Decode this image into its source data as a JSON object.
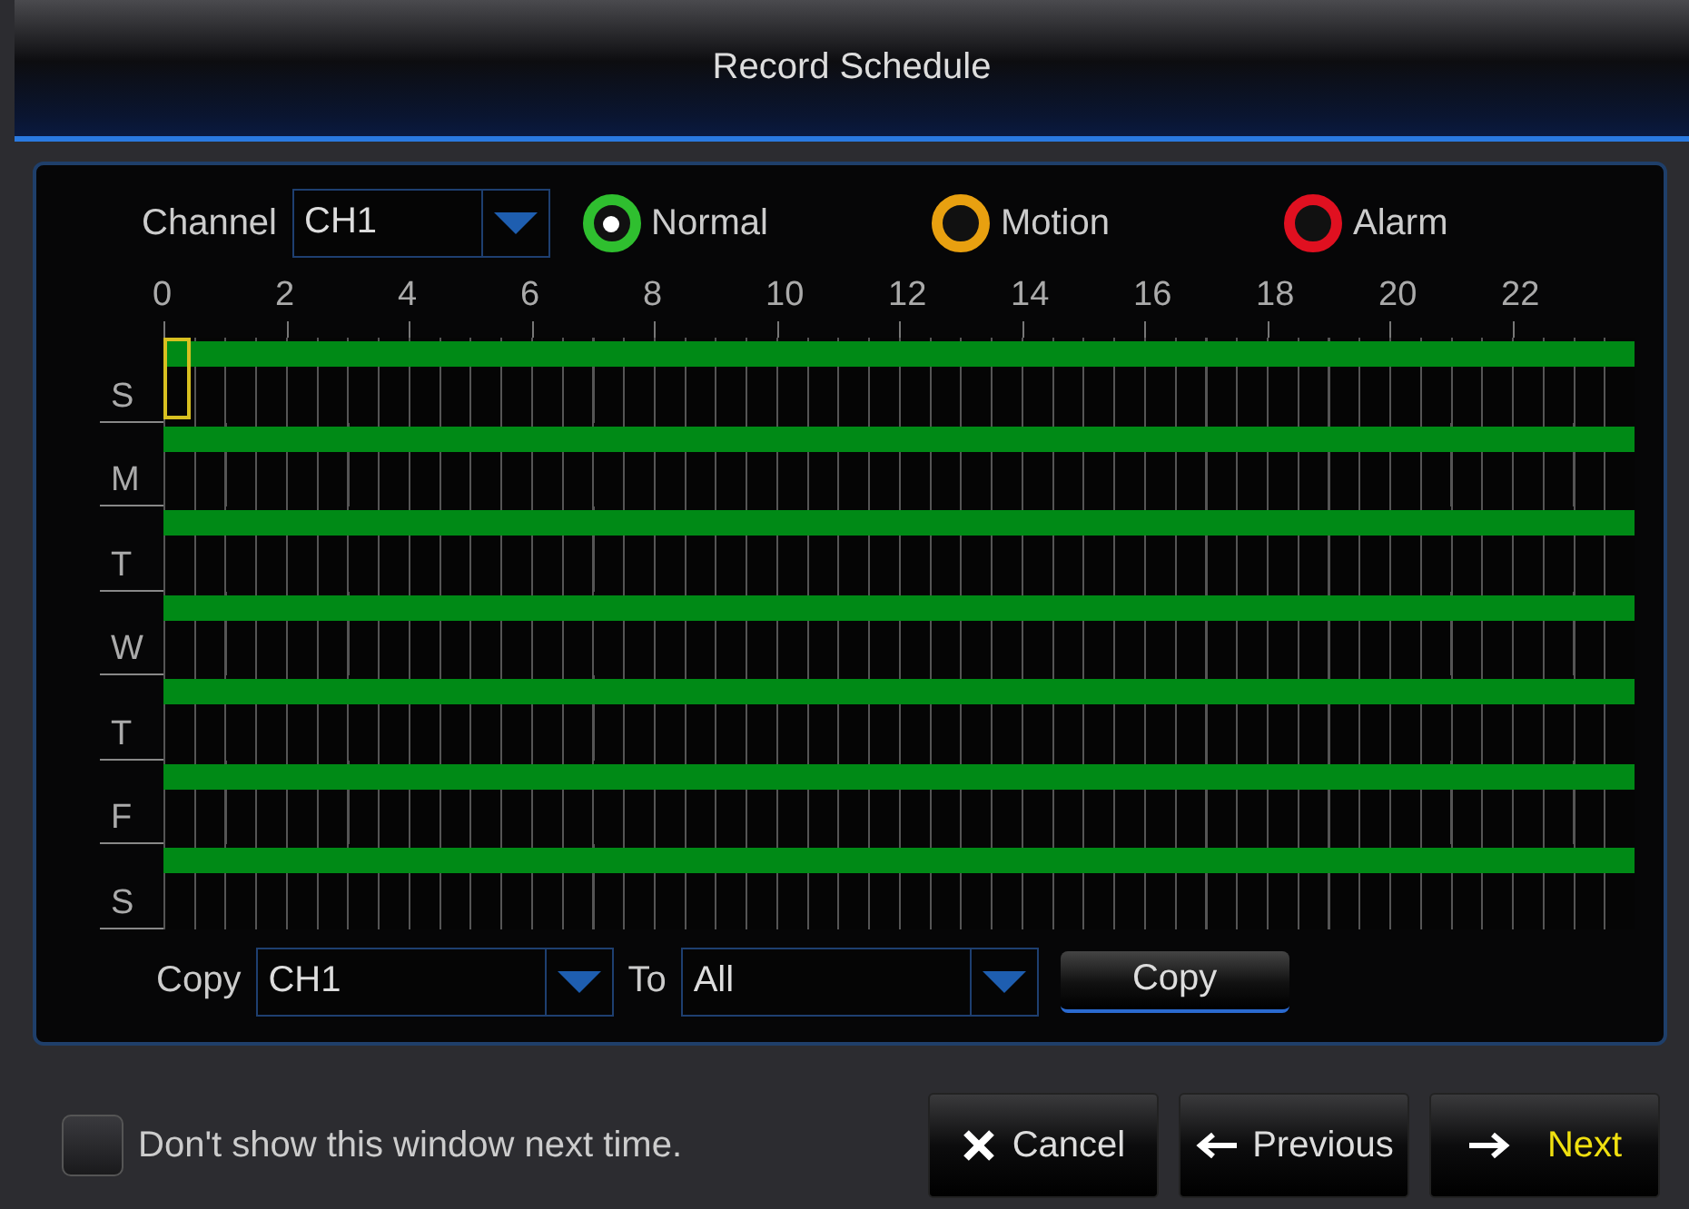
{
  "window": {
    "title": "Record Schedule"
  },
  "channel": {
    "label": "Channel",
    "value": "CH1"
  },
  "modes": [
    {
      "label": "Normal",
      "color": "#2fbf2f",
      "selected": true
    },
    {
      "label": "Motion",
      "color": "#e8a010",
      "selected": false
    },
    {
      "label": "Alarm",
      "color": "#e01020",
      "selected": false
    }
  ],
  "hours": [
    "0",
    "2",
    "4",
    "6",
    "8",
    "10",
    "12",
    "14",
    "16",
    "18",
    "20",
    "22"
  ],
  "days": [
    {
      "label": "S",
      "kind": "normal",
      "focused": true
    },
    {
      "label": "M",
      "kind": "normal",
      "focused": false
    },
    {
      "label": "T",
      "kind": "normal",
      "focused": false
    },
    {
      "label": "W",
      "kind": "normal",
      "focused": false
    },
    {
      "label": "T",
      "kind": "normal",
      "focused": false
    },
    {
      "label": "F",
      "kind": "normal",
      "focused": false
    },
    {
      "label": "S",
      "kind": "normal",
      "focused": false
    }
  ],
  "copy": {
    "label": "Copy",
    "from": "CH1",
    "to_label": "To",
    "to": "All",
    "button": "Copy"
  },
  "dont_show": {
    "label": "Don't show this window next time.",
    "checked": false
  },
  "buttons": [
    {
      "kind": "cancel",
      "label": "Cancel"
    },
    {
      "kind": "previous",
      "label": "Previous"
    },
    {
      "kind": "next",
      "label": "Next"
    }
  ]
}
